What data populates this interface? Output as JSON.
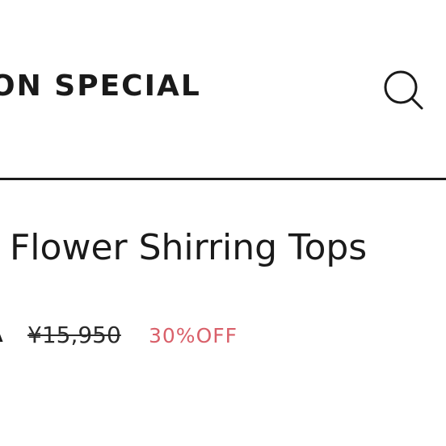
{
  "header": {
    "brand_text": "ON SPECIAL",
    "search_icon": "search-icon"
  },
  "product": {
    "title": "Flower Shirring Tops",
    "price_fragment": "Δ",
    "original_price": "¥15,950",
    "discount": "30%OFF"
  },
  "colors": {
    "text": "#1a1a1a",
    "discount": "#d9606a",
    "divider": "#1a1a1a",
    "background": "#ffffff"
  }
}
